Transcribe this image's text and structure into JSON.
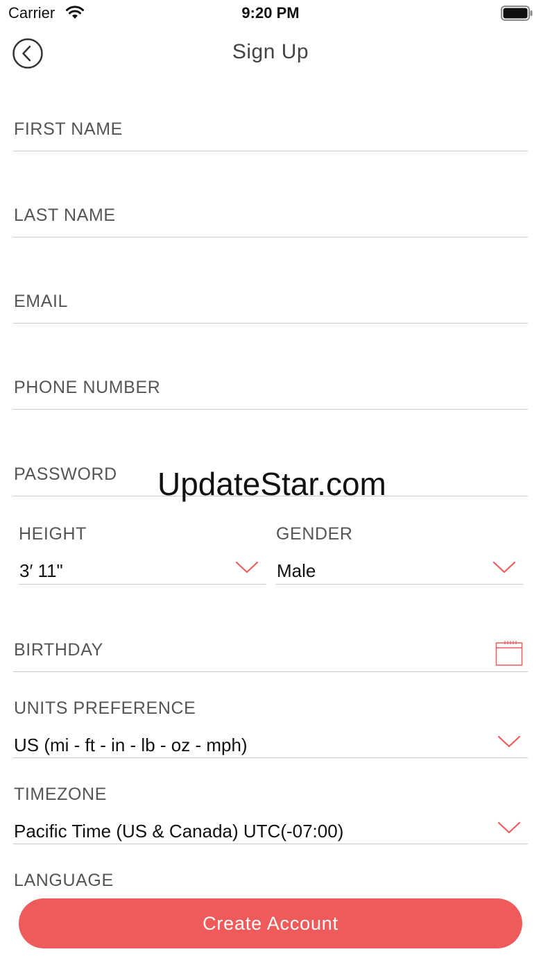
{
  "status_bar": {
    "carrier": "Carrier",
    "time": "9:20 PM"
  },
  "nav": {
    "title": "Sign Up"
  },
  "form": {
    "first_name": {
      "placeholder": "FIRST NAME"
    },
    "last_name": {
      "placeholder": "LAST NAME"
    },
    "email": {
      "placeholder": "EMAIL"
    },
    "phone_number": {
      "placeholder": "PHONE NUMBER"
    },
    "password": {
      "placeholder": "PASSWORD"
    },
    "height": {
      "label": "HEIGHT",
      "value": "3′ 11\""
    },
    "gender": {
      "label": "GENDER",
      "value": "Male"
    },
    "birthday": {
      "placeholder": "BIRTHDAY"
    },
    "units_preference": {
      "label": "UNITS PREFERENCE",
      "value": "US (mi - ft - in - lb - oz - mph)"
    },
    "timezone": {
      "label": "TIMEZONE",
      "value": "Pacific Time (US & Canada) UTC(-07:00)"
    },
    "language": {
      "label": "LANGUAGE"
    }
  },
  "watermark": "UpdateStar.com",
  "actions": {
    "create_account": "Create Account"
  },
  "colors": {
    "accent": "#ef5b5b",
    "divider": "#c9c9c9",
    "label": "#555555"
  },
  "icons": {
    "back": "chevron-left-circle-icon",
    "dropdown": "chevron-down-icon",
    "calendar": "calendar-icon"
  }
}
